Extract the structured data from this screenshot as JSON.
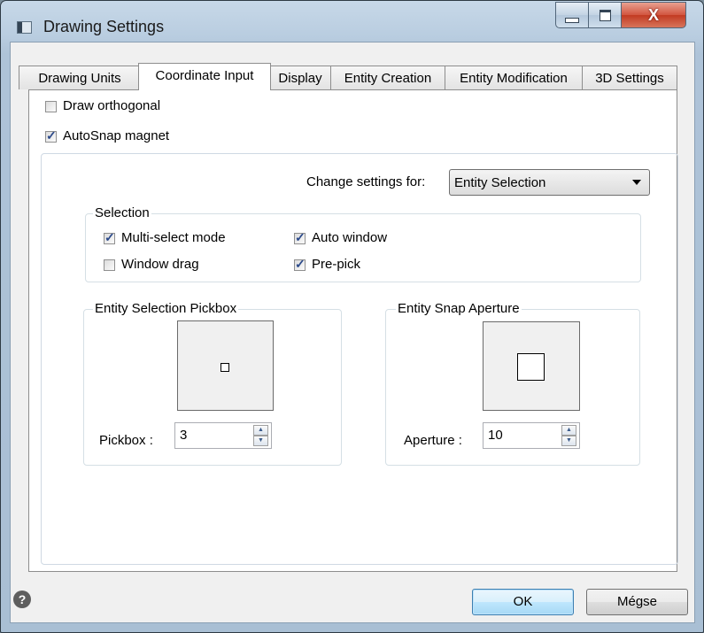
{
  "window": {
    "title": "Drawing Settings",
    "close_glyph": "X"
  },
  "tabs": [
    {
      "label": "Drawing Units"
    },
    {
      "label": "Coordinate Input"
    },
    {
      "label": "Display"
    },
    {
      "label": "Entity Creation"
    },
    {
      "label": "Entity Modification"
    },
    {
      "label": "3D Settings"
    }
  ],
  "active_tab": "Coordinate Input",
  "options": {
    "draw_orthogonal": {
      "label": "Draw orthogonal",
      "checked": false
    },
    "autosnap_magnet": {
      "label": "AutoSnap magnet",
      "checked": true
    }
  },
  "change_settings": {
    "label": "Change settings for:",
    "value": "Entity Selection"
  },
  "selection": {
    "title": "Selection",
    "multi_select": {
      "label": "Multi-select mode",
      "checked": true
    },
    "auto_window": {
      "label": "Auto window",
      "checked": true
    },
    "window_drag": {
      "label": "Window drag",
      "checked": false
    },
    "pre_pick": {
      "label": "Pre-pick",
      "checked": true
    }
  },
  "pickbox": {
    "title": "Entity Selection Pickbox",
    "label": "Pickbox :",
    "value": "3"
  },
  "aperture": {
    "title": "Entity Snap Aperture",
    "label": "Aperture :",
    "value": "10"
  },
  "footer": {
    "help_glyph": "?",
    "ok_label": "OK",
    "cancel_label": "Mégse"
  },
  "colors": {
    "title_bar": "#b9cde0",
    "close_button": "#c23b22",
    "panel": "#ffffff",
    "default_button": "#bee6fd"
  }
}
